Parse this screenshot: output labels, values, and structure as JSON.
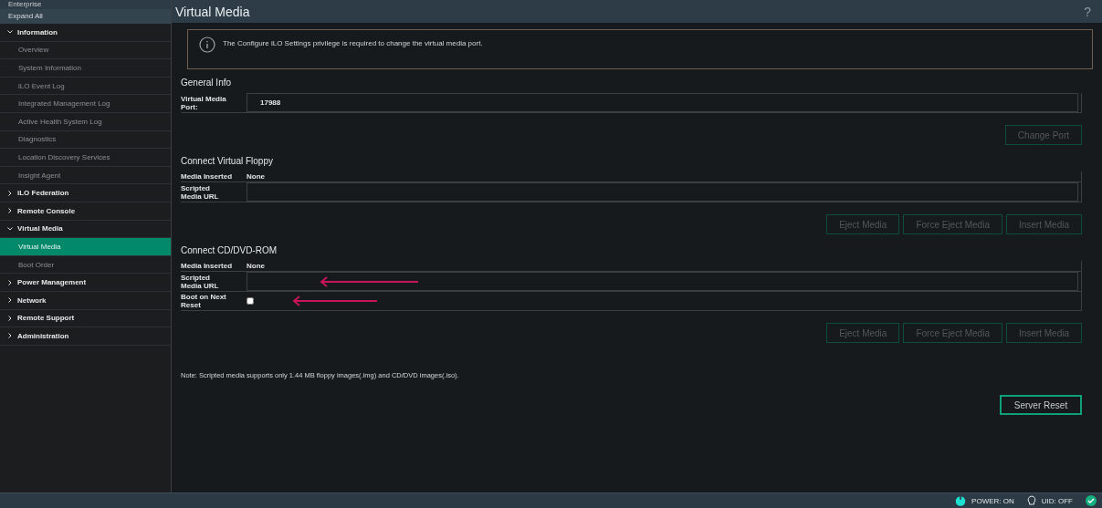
{
  "sidebar": {
    "header": "Enterprise",
    "expand_all": "Expand All",
    "items": [
      {
        "label": "Information",
        "expanded": true,
        "children": [
          {
            "label": "Overview",
            "selected": false
          },
          {
            "label": "System Information",
            "selected": false
          },
          {
            "label": "iLO Event Log",
            "selected": false
          },
          {
            "label": "Integrated Management Log",
            "selected": false
          },
          {
            "label": "Active Health System Log",
            "selected": false
          },
          {
            "label": "Diagnostics",
            "selected": false
          },
          {
            "label": "Location Discovery Services",
            "selected": false
          },
          {
            "label": "Insight Agent",
            "selected": false
          }
        ]
      },
      {
        "label": "iLO Federation",
        "expanded": false
      },
      {
        "label": "Remote Console",
        "expanded": false
      },
      {
        "label": "Virtual Media",
        "expanded": true,
        "children": [
          {
            "label": "Virtual Media",
            "selected": true
          },
          {
            "label": "Boot Order",
            "selected": false
          }
        ]
      },
      {
        "label": "Power Management",
        "expanded": false
      },
      {
        "label": "Network",
        "expanded": false
      },
      {
        "label": "Remote Support",
        "expanded": false
      },
      {
        "label": "Administration",
        "expanded": false
      }
    ]
  },
  "page": {
    "title": "Virtual Media",
    "help": "?"
  },
  "notice": "The Configure iLO Settings privilege is required to change the virtual media port.",
  "sections": [
    {
      "title": "General Info",
      "rows": [
        {
          "kind": "input",
          "label": "Virtual Media Port:",
          "value": "17988",
          "annotated": false
        }
      ],
      "buttons": [
        {
          "label": "Change Port",
          "disabled": true
        }
      ]
    },
    {
      "title": "Connect Virtual Floppy",
      "rows": [
        {
          "kind": "text",
          "label": "Media Inserted",
          "value": "None",
          "annotated": false
        },
        {
          "kind": "input",
          "label": "Scripted Media URL",
          "annotated": false
        }
      ],
      "buttons": [
        {
          "label": "Eject Media",
          "disabled": true
        },
        {
          "label": "Force Eject Media",
          "disabled": true
        },
        {
          "label": "Insert Media",
          "disabled": true
        }
      ]
    },
    {
      "title": "Connect CD/DVD-ROM",
      "rows": [
        {
          "kind": "text",
          "label": "Media Inserted",
          "value": "None",
          "annotated": false
        },
        {
          "kind": "input",
          "label": "Scripted Media URL",
          "annotated": true
        },
        {
          "kind": "checkbox",
          "label": "Boot on Next Reset",
          "checked": false,
          "annotated": true
        }
      ],
      "buttons": [
        {
          "label": "Eject Media",
          "disabled": true
        },
        {
          "label": "Force Eject Media",
          "disabled": true
        },
        {
          "label": "Insert Media",
          "disabled": true
        }
      ]
    }
  ],
  "note": "Note: Scripted media supports only 1.44 MB floppy images(.img) and CD/DVD images(.iso).",
  "server_reset": {
    "label": "Server Reset",
    "disabled": false
  },
  "status_bar": {
    "power": "POWER: ON",
    "uid": "UID: OFF"
  }
}
